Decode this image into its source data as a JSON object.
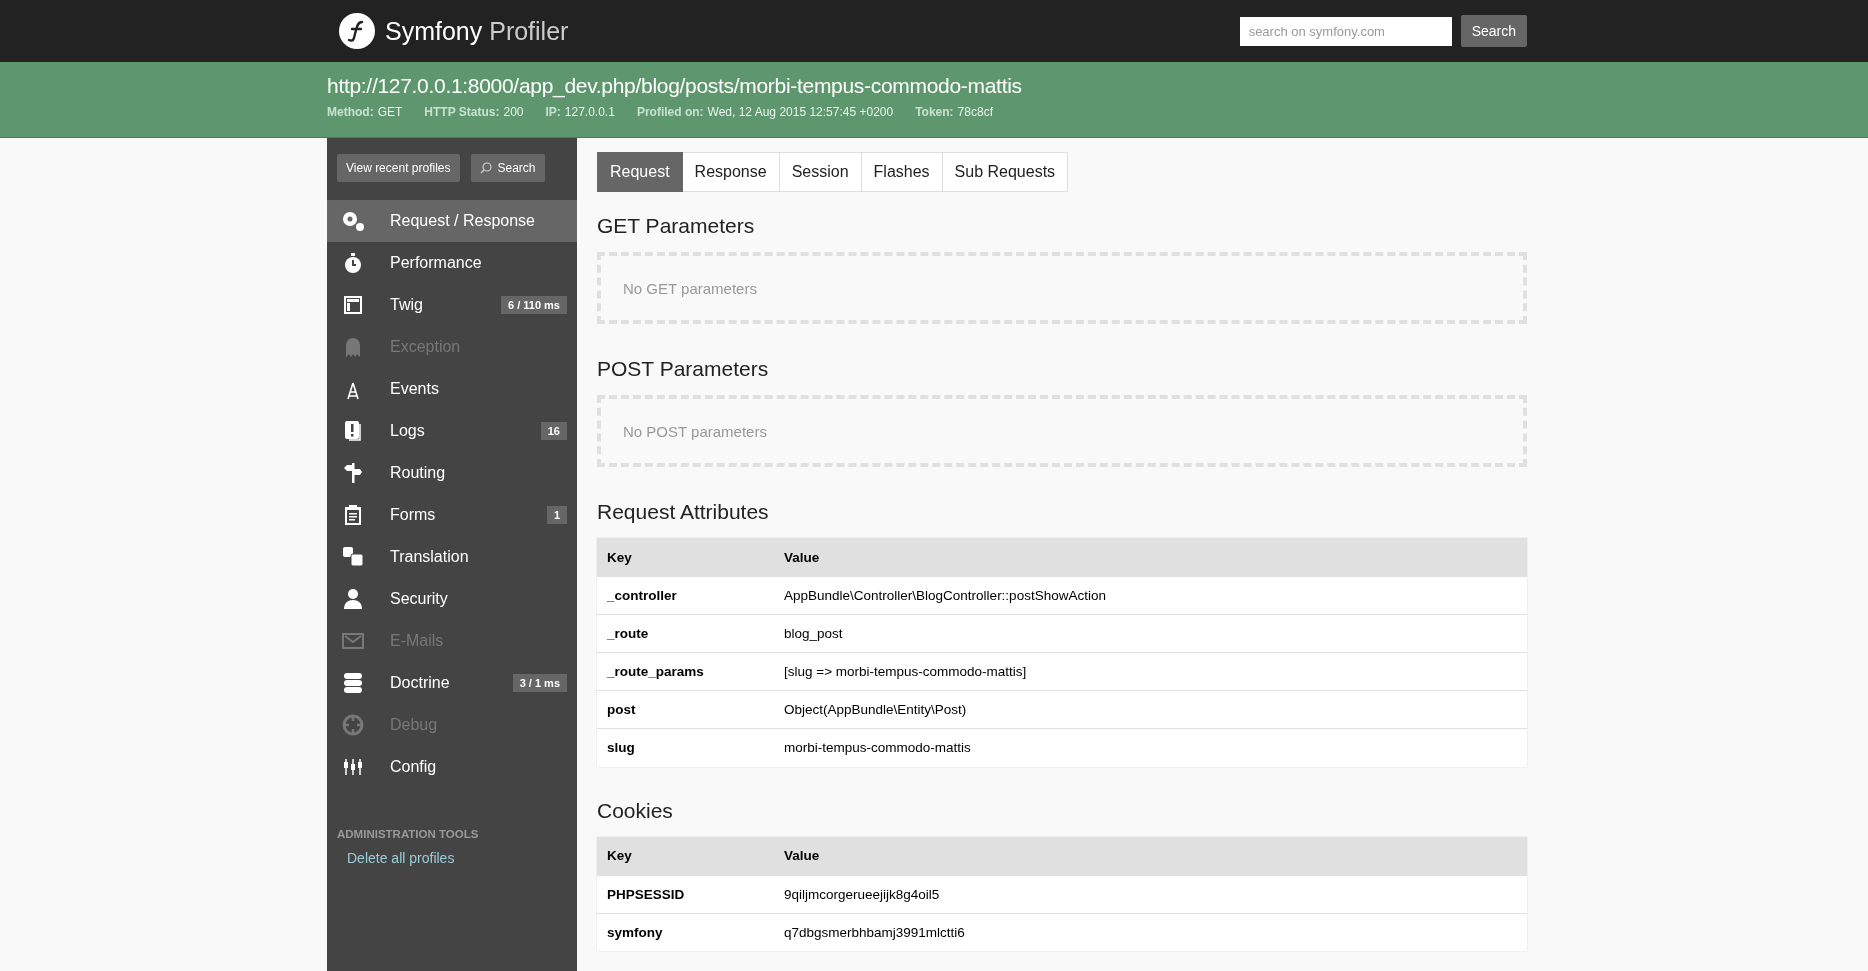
{
  "header": {
    "brand": {
      "name": "Symfony",
      "suffix": "Profiler"
    },
    "search": {
      "placeholder": "search on symfony.com"
    },
    "search_button": "Search"
  },
  "summary": {
    "url": "http://127.0.0.1:8000/app_dev.php/blog/posts/morbi-tempus-commodo-mattis",
    "meta": [
      {
        "label": "Method:",
        "value": "GET"
      },
      {
        "label": "HTTP Status:",
        "value": "200"
      },
      {
        "label": "IP:",
        "value": "127.0.0.1"
      },
      {
        "label": "Profiled on:",
        "value": "Wed, 12 Aug 2015 12:57:45 +0200"
      },
      {
        "label": "Token:",
        "value": "78c8cf"
      }
    ]
  },
  "sidebar": {
    "buttons": [
      "View recent profiles",
      "Search"
    ],
    "items": [
      {
        "label": "Request / Response",
        "selected": true,
        "disabled": false
      },
      {
        "label": "Performance",
        "selected": false,
        "disabled": false
      },
      {
        "label": "Twig",
        "selected": false,
        "disabled": false,
        "count": "6 / 110 ms"
      },
      {
        "label": "Exception",
        "selected": false,
        "disabled": true
      },
      {
        "label": "Events",
        "selected": false,
        "disabled": false
      },
      {
        "label": "Logs",
        "selected": false,
        "disabled": false,
        "count": "16"
      },
      {
        "label": "Routing",
        "selected": false,
        "disabled": false
      },
      {
        "label": "Forms",
        "selected": false,
        "disabled": false,
        "count": "1"
      },
      {
        "label": "Translation",
        "selected": false,
        "disabled": false
      },
      {
        "label": "Security",
        "selected": false,
        "disabled": false
      },
      {
        "label": "E-Mails",
        "selected": false,
        "disabled": true
      },
      {
        "label": "Doctrine",
        "selected": false,
        "disabled": false,
        "count": "3 / 1 ms"
      },
      {
        "label": "Debug",
        "selected": false,
        "disabled": true
      },
      {
        "label": "Config",
        "selected": false,
        "disabled": false
      }
    ],
    "admin": {
      "title": "ADMINISTRATION TOOLS",
      "link": "Delete all profiles"
    }
  },
  "tabs": [
    {
      "label": "Request",
      "selected": true
    },
    {
      "label": "Response",
      "selected": false
    },
    {
      "label": "Session",
      "selected": false
    },
    {
      "label": "Flashes",
      "selected": false
    },
    {
      "label": "Sub Requests",
      "selected": false
    }
  ],
  "sections": [
    {
      "kind": "empty",
      "title": "GET Parameters",
      "message": "No GET parameters"
    },
    {
      "kind": "empty",
      "title": "POST Parameters",
      "message": "No POST parameters"
    },
    {
      "kind": "table",
      "title": "Request Attributes",
      "columns": [
        "Key",
        "Value"
      ],
      "rows": [
        [
          "_controller",
          "AppBundle\\Controller\\BlogController::postShowAction"
        ],
        [
          "_route",
          "blog_post"
        ],
        [
          "_route_params",
          "[slug => morbi-tempus-commodo-mattis]"
        ],
        [
          "post",
          "Object(AppBundle\\Entity\\Post)"
        ],
        [
          "slug",
          "morbi-tempus-commodo-mattis"
        ]
      ]
    },
    {
      "kind": "table",
      "title": "Cookies",
      "columns": [
        "Key",
        "Value"
      ],
      "rows": [
        [
          "PHPSESSID",
          "9qiljmcorgerueejijk8g4oil5"
        ],
        [
          "symfony",
          "q7dbgsmerbhbamj3991mlctti6"
        ]
      ]
    }
  ]
}
